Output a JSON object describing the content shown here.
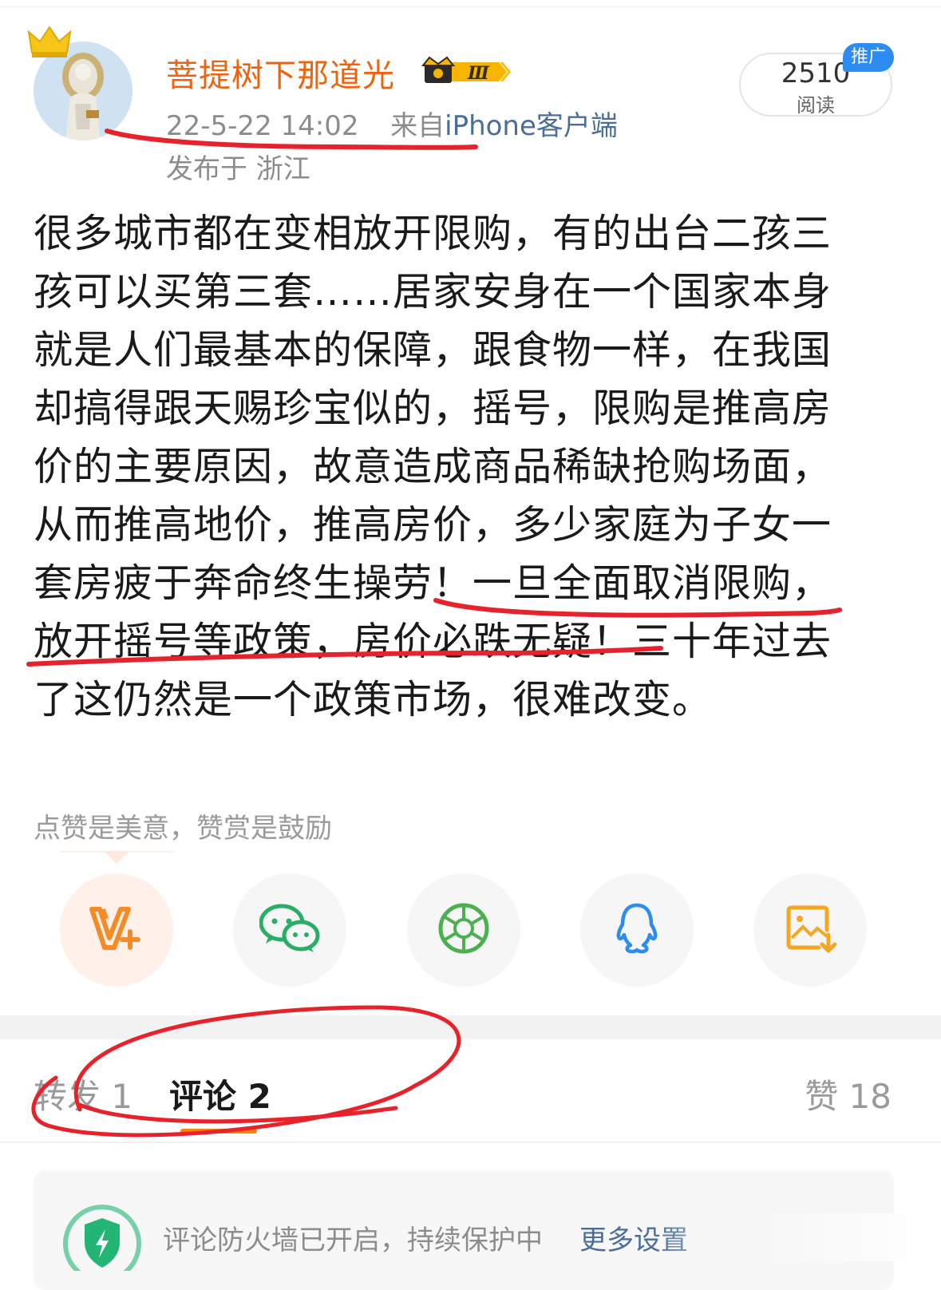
{
  "header": {
    "username": "菩提树下那道光",
    "vip_level": "Ⅲ",
    "date_time": "22-5-22 14:02",
    "source_prefix": "来自",
    "source": "iPhone客户端",
    "location": "发布于 浙江",
    "reads_count": "2510",
    "reads_label": "阅读",
    "promo_badge": "推广"
  },
  "post": {
    "text": "很多城市都在变相放开限购，有的出台二孩三\n孩可以买第三套……居家安身在一个国家本身\n就是人们最基本的保障，跟食物一样，在我国\n却搞得跟天赐珍宝似的，摇号，限购是推高房\n价的主要原因，故意造成商品稀缺抢购场面，\n从而推高地价，推高房价，多少家庭为子女一\n套房疲于奔命终生操劳！一旦全面取消限购，\n放开摇号等政策，房价必跌无疑！三十年过去\n了这仍然是一个政策市场，很难改变。"
  },
  "reward_hint": "点赞是美意，赞赏是鼓励",
  "share_icons": [
    "reward-v-plus-icon",
    "wechat-icon",
    "moments-icon",
    "qq-icon",
    "save-image-icon"
  ],
  "tabs": {
    "repost": "转发 1",
    "comment": "评论 2",
    "like": "赞 18"
  },
  "firewall": {
    "text": "评论防火墙已开启，持续保护中",
    "link": "更多设置"
  },
  "colors": {
    "username": "#f0620d",
    "link": "#4a6e99",
    "accent": "#ff8200",
    "annotation_red": "#e8222a"
  }
}
